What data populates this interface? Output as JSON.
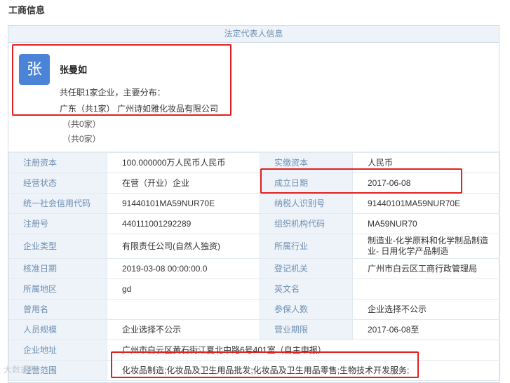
{
  "page": {
    "title": "工商信息"
  },
  "legal_rep": {
    "header": "法定代表人信息",
    "avatar_char": "张",
    "name": "张曼如",
    "summary": "共任职1家企业，主要分布：",
    "region_line": "广东（共1家） 广州诗如雅化妆品有限公司",
    "other_1": "（共0家）",
    "other_2": "（共0家）"
  },
  "info_rows": [
    {
      "label1": "注册资本",
      "value1": "100.000000万人民币人民币",
      "label2": "实缴资本",
      "value2": "人民币"
    },
    {
      "label1": "经营状态",
      "value1": "在营（开业）企业",
      "label2": "成立日期",
      "value2": "2017-06-08"
    },
    {
      "label1": "统一社会信用代码",
      "value1": "91440101MA59NUR70E",
      "label2": "纳税人识别号",
      "value2": "91440101MA59NUR70E"
    },
    {
      "label1": "注册号",
      "value1": "440111001292289",
      "label2": "组织机构代码",
      "value2": "MA59NUR70"
    },
    {
      "label1": "企业类型",
      "value1": "有限责任公司(自然人独资)",
      "label2": "所属行业",
      "value2": "制造业-化学原料和化学制品制造业- 日用化学产品制造"
    },
    {
      "label1": "核准日期",
      "value1": "2019-03-08 00:00:00.0",
      "label2": "登记机关",
      "value2": "广州市白云区工商行政管理局"
    },
    {
      "label1": "所属地区",
      "value1": "gd",
      "label2": "英文名",
      "value2": ""
    },
    {
      "label1": "曾用名",
      "value1": "",
      "label2": "参保人数",
      "value2": "企业选择不公示"
    },
    {
      "label1": "人员规模",
      "value1": "企业选择不公示",
      "label2": "营业期限",
      "value2": "2017-06-08至"
    }
  ],
  "address": {
    "label": "企业地址",
    "value": "广州市白云区黄石街江夏北中路6号401室（自主申报）"
  },
  "scope": {
    "label": "经营范围",
    "value": "化妆品制造;化妆品及卫生用品批发;化妆品及卫生用品零售;生物技术开发服务;"
  },
  "watermark": "大数据局",
  "colors": {
    "highlight": "#e31f1f",
    "avatar": "#4b84d7",
    "label_bg": "#eef3f9",
    "label_text": "#6d8fb2"
  }
}
